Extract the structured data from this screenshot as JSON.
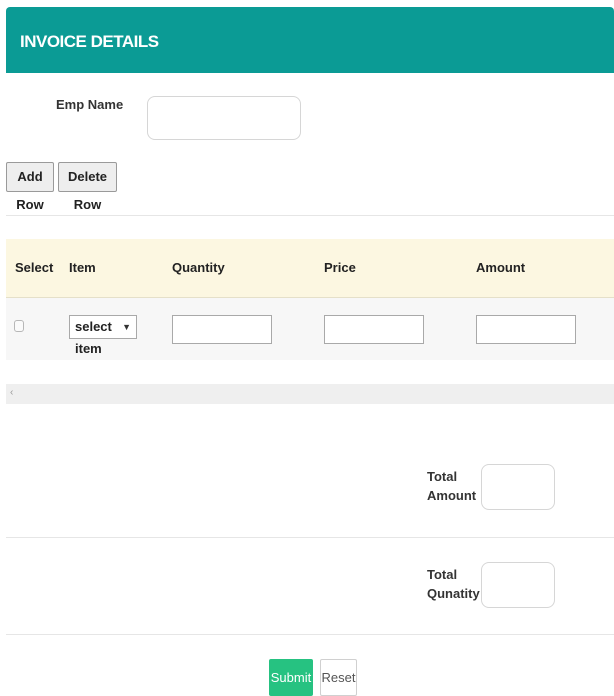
{
  "header": {
    "title": "INVOICE DETAILS"
  },
  "form": {
    "emp_name_label": "Emp Name",
    "emp_name_value": "",
    "add_row_label": "Add Row",
    "delete_row_label": "Delete Row"
  },
  "table": {
    "headers": [
      "Select",
      "Item",
      "Quantity",
      "Price",
      "Amount"
    ],
    "rows": [
      {
        "selected": false,
        "item": "select item",
        "quantity": "",
        "price": "",
        "amount": ""
      }
    ]
  },
  "totals": {
    "amount_label_line1": "Total",
    "amount_label_line2": "Amount",
    "amount_value": "",
    "quantity_label_line1": "Total",
    "quantity_label_line2": "Qunatity",
    "quantity_value": ""
  },
  "actions": {
    "submit_label": "Submit",
    "reset_label": "Reset"
  },
  "colors": {
    "header_bg": "#0b9b95",
    "table_head_bg": "#fcf7e1",
    "submit_bg": "#26c281"
  },
  "icons": {
    "select_arrow": "dropdown-arrow-icon",
    "scroll_left": "scroll-left-arrow-icon"
  }
}
